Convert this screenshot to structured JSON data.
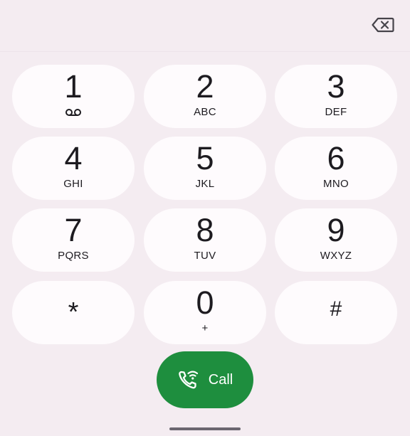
{
  "topbar": {
    "backspace_icon": "backspace-icon"
  },
  "keypad": {
    "keys": [
      {
        "digit": "1",
        "letters": "",
        "icon": "voicemail-icon"
      },
      {
        "digit": "2",
        "letters": "ABC"
      },
      {
        "digit": "3",
        "letters": "DEF"
      },
      {
        "digit": "4",
        "letters": "GHI"
      },
      {
        "digit": "5",
        "letters": "JKL"
      },
      {
        "digit": "6",
        "letters": "MNO"
      },
      {
        "digit": "7",
        "letters": "PQRS"
      },
      {
        "digit": "8",
        "letters": "TUV"
      },
      {
        "digit": "9",
        "letters": "WXYZ"
      },
      {
        "digit": "*",
        "letters": ""
      },
      {
        "digit": "0",
        "letters": "+"
      },
      {
        "digit": "#",
        "letters": ""
      }
    ]
  },
  "call": {
    "label": "Call",
    "icon": "wifi-call-icon",
    "color": "#1e8e3e"
  }
}
